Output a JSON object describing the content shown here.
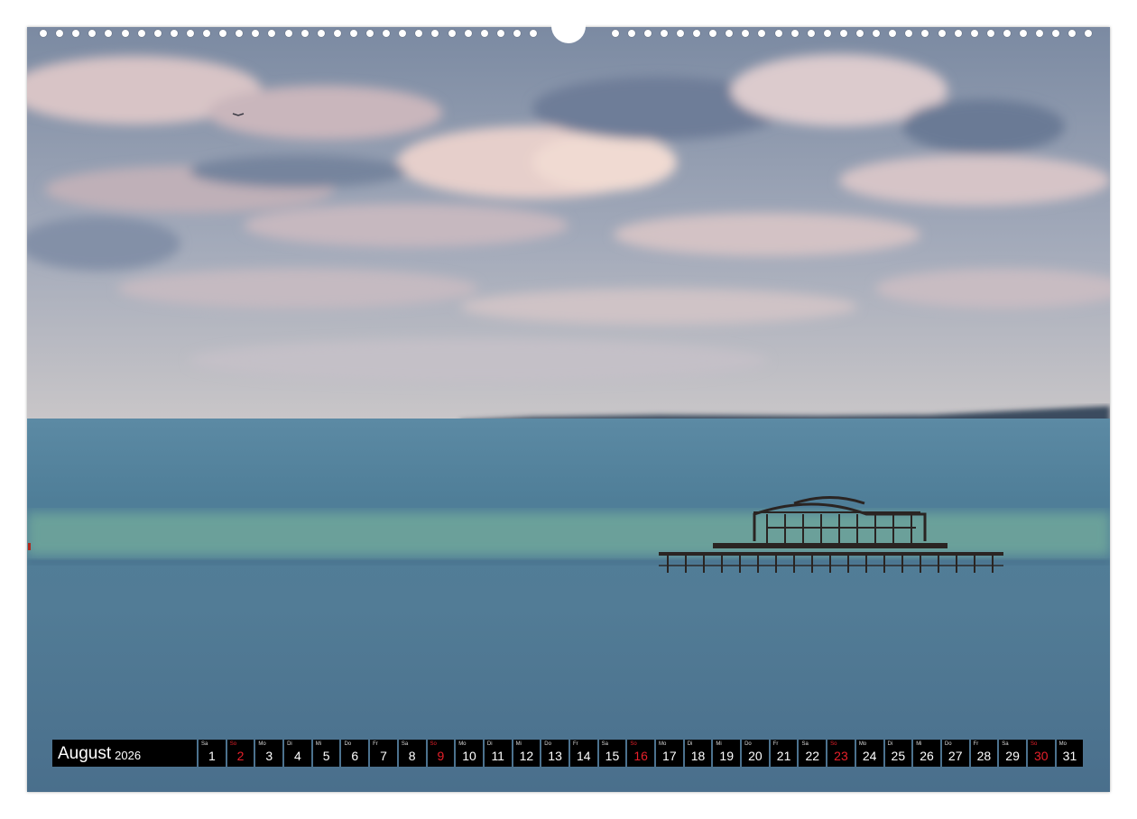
{
  "calendar": {
    "month": "August",
    "year": "2026",
    "days": [
      {
        "weekday": "Sa",
        "day": "1",
        "red": false
      },
      {
        "weekday": "So",
        "day": "2",
        "red": true
      },
      {
        "weekday": "Mo",
        "day": "3",
        "red": false
      },
      {
        "weekday": "Di",
        "day": "4",
        "red": false
      },
      {
        "weekday": "Mi",
        "day": "5",
        "red": false
      },
      {
        "weekday": "Do",
        "day": "6",
        "red": false
      },
      {
        "weekday": "Fr",
        "day": "7",
        "red": false
      },
      {
        "weekday": "Sa",
        "day": "8",
        "red": false
      },
      {
        "weekday": "So",
        "day": "9",
        "red": true
      },
      {
        "weekday": "Mo",
        "day": "10",
        "red": false
      },
      {
        "weekday": "Di",
        "day": "11",
        "red": false
      },
      {
        "weekday": "Mi",
        "day": "12",
        "red": false
      },
      {
        "weekday": "Do",
        "day": "13",
        "red": false
      },
      {
        "weekday": "Fr",
        "day": "14",
        "red": false
      },
      {
        "weekday": "Sa",
        "day": "15",
        "red": false
      },
      {
        "weekday": "So",
        "day": "16",
        "red": true
      },
      {
        "weekday": "Mo",
        "day": "17",
        "red": false
      },
      {
        "weekday": "Di",
        "day": "18",
        "red": false
      },
      {
        "weekday": "Mi",
        "day": "19",
        "red": false
      },
      {
        "weekday": "Do",
        "day": "20",
        "red": false
      },
      {
        "weekday": "Fr",
        "day": "21",
        "red": false
      },
      {
        "weekday": "Sa",
        "day": "22",
        "red": false
      },
      {
        "weekday": "So",
        "day": "23",
        "red": true
      },
      {
        "weekday": "Mo",
        "day": "24",
        "red": false
      },
      {
        "weekday": "Di",
        "day": "25",
        "red": false
      },
      {
        "weekday": "Mi",
        "day": "26",
        "red": false
      },
      {
        "weekday": "Do",
        "day": "27",
        "red": false
      },
      {
        "weekday": "Fr",
        "day": "28",
        "red": false
      },
      {
        "weekday": "Sa",
        "day": "29",
        "red": false
      },
      {
        "weekday": "So",
        "day": "30",
        "red": true
      },
      {
        "weekday": "Mo",
        "day": "31",
        "red": false
      }
    ]
  },
  "colors": {
    "sunday_red": "#e8202a",
    "strip_black": "#000000",
    "sky_blue": "#7e8ea6",
    "sea_blue": "#4e7390",
    "sea_green": "#6fa79b"
  }
}
